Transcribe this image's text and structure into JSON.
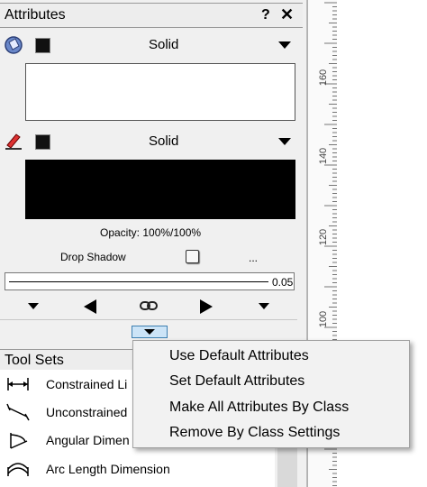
{
  "palette": {
    "title": "Attributes",
    "help_icon_label": "?",
    "close_icon_label": "✕",
    "fill": {
      "style": "Solid",
      "icon": "fill-bucket-icon",
      "swatch_color": "#111111",
      "preview_color": "#ffffff"
    },
    "pen": {
      "style": "Solid",
      "icon": "pen-icon",
      "swatch_color": "#111111",
      "preview_color": "#000000"
    },
    "opacity_text": "Opacity: 100%/100%",
    "drop_shadow_label": "Drop Shadow",
    "drop_shadow_more": "...",
    "line_weight_value": "0.05"
  },
  "tool_sets": {
    "title": "Tool Sets",
    "items": [
      {
        "label": "Constrained Li",
        "icon": "constrained-linear-dimension-icon"
      },
      {
        "label": "Unconstrained",
        "icon": "unconstrained-dimension-icon"
      },
      {
        "label": "Angular Dimen",
        "icon": "angular-dimension-icon"
      },
      {
        "label": "Arc Length Dimension",
        "icon": "arc-length-dimension-icon"
      }
    ]
  },
  "context_menu": {
    "items": [
      "Use Default Attributes",
      "Set Default Attributes",
      "Make All Attributes By Class",
      "Remove By Class Settings"
    ]
  },
  "ruler": {
    "labels": [
      "160",
      "140",
      "120",
      "100"
    ]
  }
}
